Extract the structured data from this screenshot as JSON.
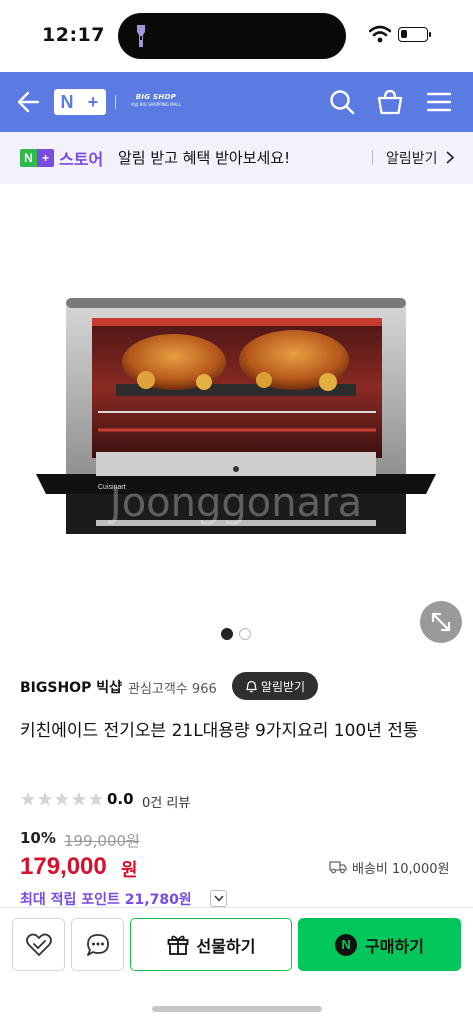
{
  "status_bar": {
    "time": "12:17",
    "battery_level": 0.25
  },
  "header": {
    "nplus_left": "N",
    "nplus_right": "+",
    "shop_logo_title": "BIG SHOP",
    "shop_logo_sub": "빅샵 BIG SHOPPING MALL"
  },
  "banner": {
    "badge_left": "N",
    "badge_right": "+",
    "store": "스토어",
    "message": "알림 받고 혜택 받아보세요!",
    "link": "알림받기"
  },
  "gallery": {
    "image_count": 2,
    "current": 1,
    "watermark": "Joonggonara",
    "control_label_left": "Cuisinart"
  },
  "product": {
    "seller": "BIGSHOP 빅샵",
    "fans": "관심고객수 966",
    "alarm_button": "알림받기",
    "title": "키친에이드 전기오븐 21L대용량 9가지요리 100년 전통",
    "rating_value": 0,
    "rating": "0.0",
    "reviews": "0건 리뷰",
    "discount": "10%",
    "original_price": "199,000원",
    "price": "179,000",
    "currency": "원",
    "shipping": "배송비 10,000원",
    "points": "최대 적립 포인트 21,780원"
  },
  "bottom_bar": {
    "gift_label": "선물하기",
    "buy_label": "구매하기",
    "buy_badge": "N"
  },
  "colors": {
    "header_blue": "#5b7be2",
    "naver_green": "#03c75a",
    "price_red": "#d90f2e",
    "points_purple": "#7a4be0"
  }
}
